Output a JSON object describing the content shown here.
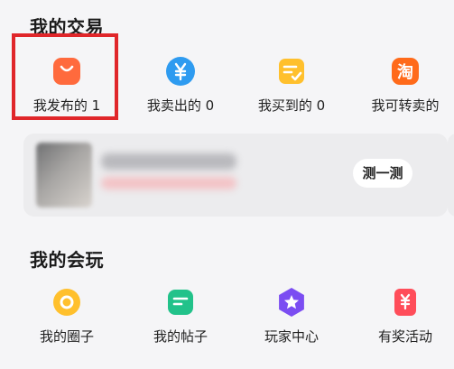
{
  "trade": {
    "title": "我的交易",
    "items": [
      {
        "label": "我发布的 1",
        "icon": "shopping-bag-icon"
      },
      {
        "label": "我卖出的 0",
        "icon": "yen-coin-icon"
      },
      {
        "label": "我买到的 0",
        "icon": "checked-document-icon"
      },
      {
        "label": "我可转卖的",
        "icon": "tao-resell-icon"
      }
    ]
  },
  "card": {
    "button_label": "测一测"
  },
  "play": {
    "title": "我的会玩",
    "items": [
      {
        "label": "我的圈子",
        "icon": "circle-ring-icon"
      },
      {
        "label": "我的帖子",
        "icon": "post-note-icon"
      },
      {
        "label": "玩家中心",
        "icon": "star-badge-icon"
      },
      {
        "label": "有奖活动",
        "icon": "prize-yen-icon"
      }
    ]
  },
  "colors": {
    "highlight": "#e0262a",
    "orange": "#ff6a3d",
    "blue": "#2e9bf0",
    "yellow": "#ffc02d",
    "resell": "#ff6a1a",
    "green": "#22c28a",
    "purple": "#7b4df2",
    "red": "#ff4d5a"
  }
}
